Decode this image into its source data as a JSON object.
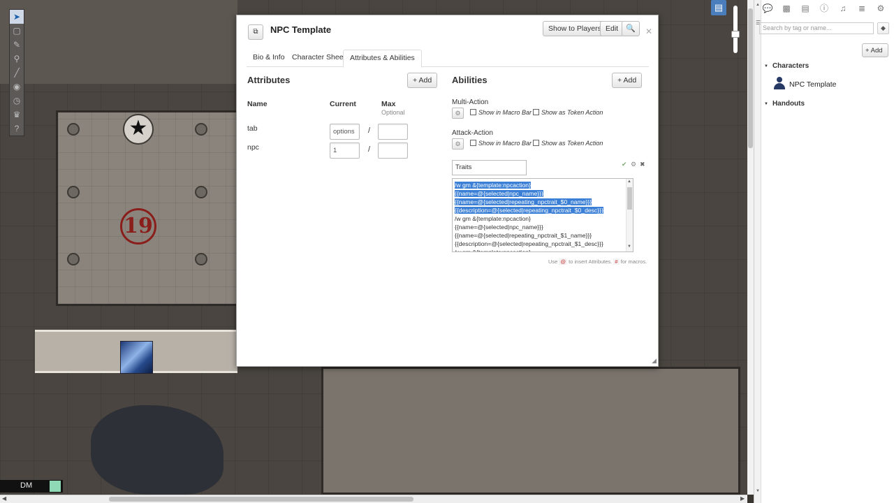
{
  "player": {
    "name": "DM",
    "color": "#8fd9b7"
  },
  "map": {
    "room_number": "19"
  },
  "toolbar": {
    "tools": [
      "select-icon",
      "cube-icon",
      "pencil-icon",
      "zoom-icon",
      "ruler-icon",
      "eye-icon",
      "clock-icon",
      "crown-icon",
      "help-icon"
    ]
  },
  "dialog": {
    "title": "NPC Template",
    "buttons": {
      "show": "Show to Players",
      "edit": "Edit",
      "search": "🔍"
    },
    "tabs": [
      "Bio & Info",
      "Character Sheet",
      "Attributes & Abilities"
    ],
    "active_tab": 2,
    "attributes": {
      "heading": "Attributes",
      "add_label": "+ Add",
      "col_name": "Name",
      "col_current": "Current",
      "col_max": "Max",
      "col_max_sub": "Optional",
      "rows": [
        {
          "name": "tab",
          "current": "options",
          "max": ""
        },
        {
          "name": "npc",
          "current": "1",
          "max": ""
        }
      ]
    },
    "abilities": {
      "heading": "Abilities",
      "add_label": "+ Add",
      "macro_bar_label": "Show in Macro Bar",
      "token_action_label": "Show as Token Action",
      "items": [
        {
          "name": "Multi-Action"
        },
        {
          "name": "Attack-Action"
        }
      ],
      "editing": {
        "name": "Traits",
        "macro_lines": [
          "/w gm &{template:npcaction}",
          "{{name=@{selected|npc_name}}}",
          "{{name=@{selected|repeating_npctrait_$0_name}}}",
          "{{description=@{selected|repeating_npctrait_$0_desc}}}",
          "/w gm &{template:npcaction}",
          "{{name=@{selected|npc_name}}}",
          "{{name=@{selected|repeating_npctrait_$1_name}}}",
          "{{description=@{selected|repeating_npctrait_$1_desc}}}",
          "/w gm &{template:npcaction}"
        ],
        "selected_lines": 4,
        "hint_use": "Use",
        "hint_at": "@",
        "hint_attr": "to insert Attributes.",
        "hint_hash": "#",
        "hint_macro": "for macros."
      }
    }
  },
  "sidebar": {
    "search_placeholder": "Search by tag or name...",
    "add_label": "+ Add",
    "folders": {
      "characters": "Characters",
      "handouts": "Handouts"
    },
    "characters": [
      "NPC Template"
    ],
    "tab_icons": [
      "chat-icon",
      "art-icon",
      "journal-icon",
      "info-icon",
      "jukebox-icon",
      "list-icon",
      "settings-icon"
    ]
  }
}
